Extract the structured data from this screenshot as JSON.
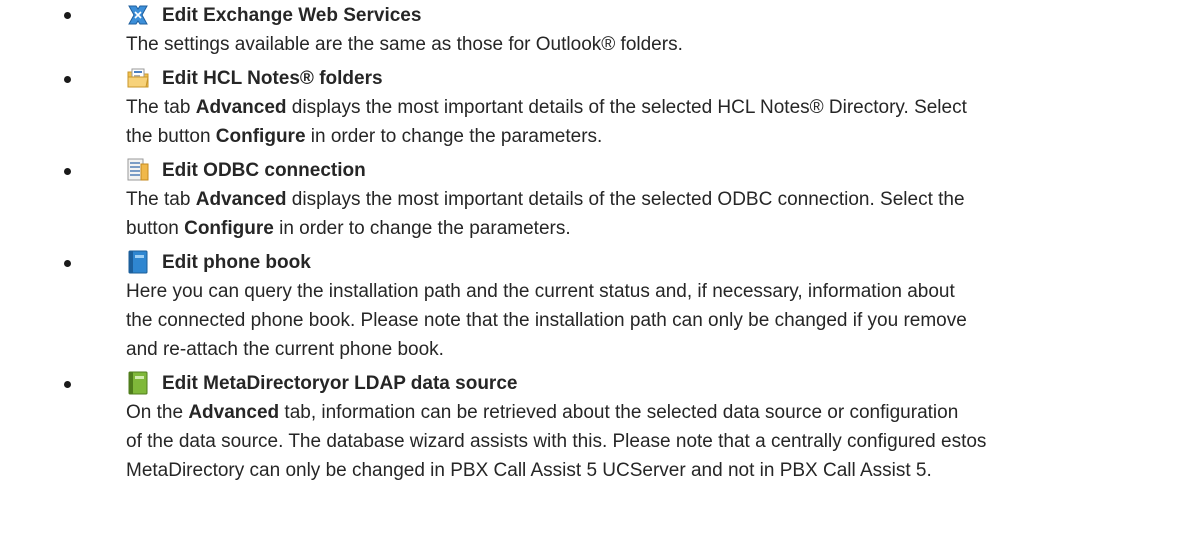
{
  "items": [
    {
      "icon": "exchange-web-services-icon",
      "title": "Edit Exchange Web Services",
      "lines": [
        [
          "The settings available are the same as those for Outlook® folders."
        ]
      ]
    },
    {
      "icon": "hcl-notes-folder-icon",
      "title": "Edit HCL Notes® folders",
      "lines": [
        [
          "The tab ",
          "Advanced",
          " displays the most important details of the selected HCL Notes® Directory. Select"
        ],
        [
          "the button ",
          "Configure",
          " in order to change the parameters."
        ]
      ]
    },
    {
      "icon": "odbc-connection-icon",
      "title": "Edit ODBC connection",
      "lines": [
        [
          "The tab ",
          "Advanced",
          " displays the most important details of the selected ODBC connection. Select the"
        ],
        [
          "button ",
          "Configure",
          " in order to change the parameters."
        ]
      ]
    },
    {
      "icon": "phone-book-icon",
      "title": "Edit phone book",
      "lines": [
        [
          "Here you can query the installation path and the current status and, if necessary, information about"
        ],
        [
          "the connected phone book. Please note that the installation path can only be changed if you remove"
        ],
        [
          "and re-attach the current phone book."
        ]
      ]
    },
    {
      "icon": "metadirectory-ldap-icon",
      "title": "Edit MetaDirectoryor LDAP data source",
      "lines": [
        [
          "On the ",
          "Advanced",
          " tab, information can be retrieved about the selected data source or configuration"
        ],
        [
          "of the data source. The database wizard assists with this. Please note that a centrally configured estos"
        ],
        [
          "MetaDirectory can only be changed in PBX Call Assist 5 UCServer and not in PBX Call Assist 5."
        ]
      ]
    }
  ]
}
